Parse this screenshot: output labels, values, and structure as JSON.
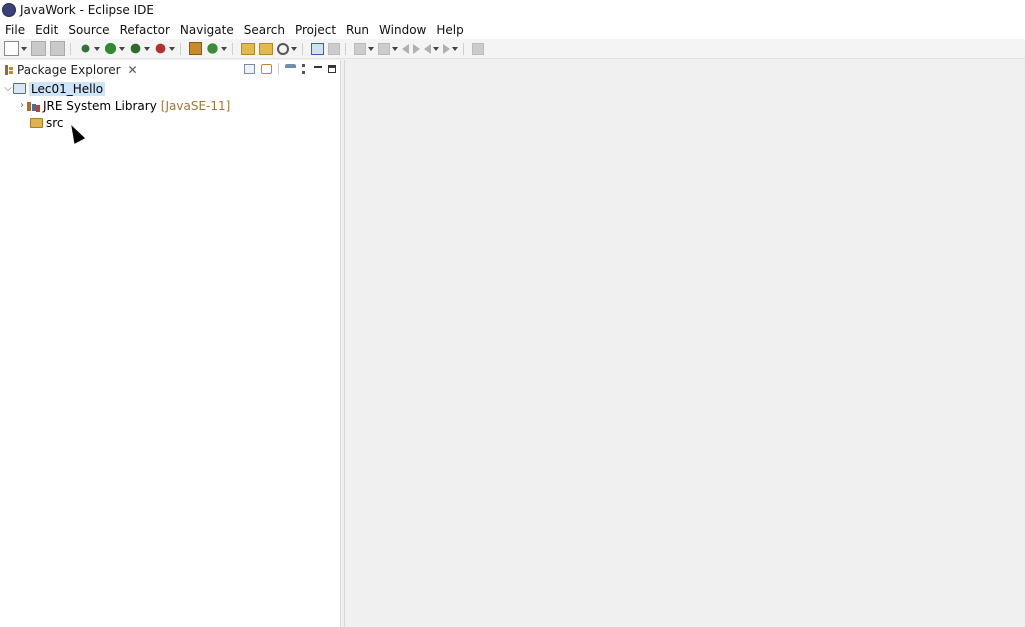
{
  "window": {
    "title": "JavaWork - Eclipse IDE"
  },
  "menu": [
    "File",
    "Edit",
    "Source",
    "Refactor",
    "Navigate",
    "Search",
    "Project",
    "Run",
    "Window",
    "Help"
  ],
  "package_explorer": {
    "title": "Package Explorer",
    "close_glyph": "✕",
    "tree": {
      "project": {
        "name": "Lec01_Hello",
        "twisty": "⌵"
      },
      "library": {
        "name": "JRE System Library",
        "decoration": "[JavaSE-11]",
        "twisty": "›"
      },
      "src": {
        "name": "src"
      }
    }
  }
}
